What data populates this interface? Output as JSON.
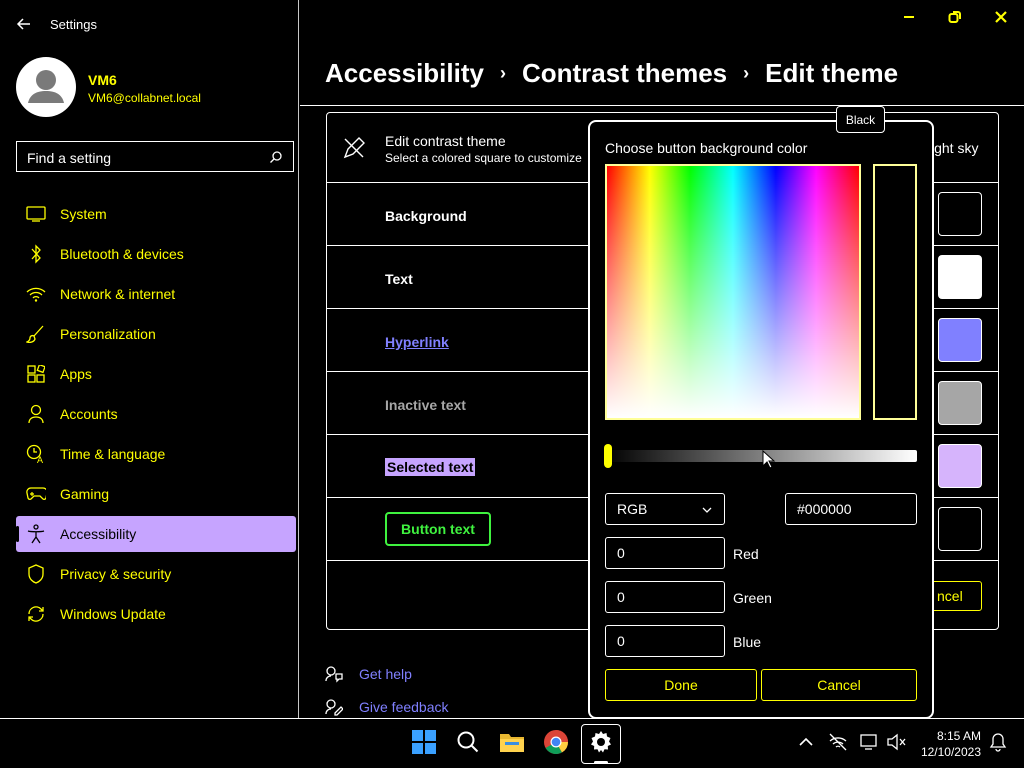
{
  "window": {
    "title": "Settings"
  },
  "user": {
    "name": "VM6",
    "email": "VM6@collabnet.local"
  },
  "search": {
    "placeholder": "Find a setting"
  },
  "nav": {
    "items": [
      {
        "label": "System",
        "icon": "monitor-icon"
      },
      {
        "label": "Bluetooth & devices",
        "icon": "bluetooth-icon"
      },
      {
        "label": "Network & internet",
        "icon": "wifi-icon"
      },
      {
        "label": "Personalization",
        "icon": "brush-icon"
      },
      {
        "label": "Apps",
        "icon": "apps-icon"
      },
      {
        "label": "Accounts",
        "icon": "person-icon"
      },
      {
        "label": "Time & language",
        "icon": "clock-language-icon"
      },
      {
        "label": "Gaming",
        "icon": "gamepad-icon"
      },
      {
        "label": "Accessibility",
        "icon": "accessibility-icon",
        "active": true
      },
      {
        "label": "Privacy & security",
        "icon": "shield-icon"
      },
      {
        "label": "Windows Update",
        "icon": "update-icon"
      }
    ]
  },
  "breadcrumb": {
    "part1": "Accessibility",
    "part2": "Contrast themes",
    "part3": "Edit theme",
    "sep": "›"
  },
  "panel": {
    "title": "Edit contrast theme",
    "subtitle": "Select a colored square to customize",
    "theme_name": "ight sky",
    "rows": {
      "background": "Background",
      "text": "Text",
      "hyperlink": "Hyperlink",
      "inactive": "Inactive text",
      "selected": "Selected text",
      "button": "Button text"
    },
    "swatch_colors": [
      "#000000",
      "#ffffff",
      "#8080ff",
      "#a6a6a6",
      "#d6b4fc",
      "#000000"
    ],
    "cancel_partial": "ncel"
  },
  "dialog": {
    "title": "Choose button background color",
    "tooltip": "Black",
    "mode": "RGB",
    "hex": "#000000",
    "red": {
      "label": "Red",
      "value": "0"
    },
    "green": {
      "label": "Green",
      "value": "0"
    },
    "blue": {
      "label": "Blue",
      "value": "0"
    },
    "done": "Done",
    "cancel": "Cancel"
  },
  "help": {
    "get_help": "Get help",
    "feedback": "Give feedback"
  },
  "taskbar": {
    "time": "8:15 AM",
    "date": "12/10/2023"
  },
  "colors": {
    "accent": "#ffff00",
    "nav_active": "#c6a4ff",
    "link": "#8080ff",
    "button_text": "#3ff23f"
  }
}
